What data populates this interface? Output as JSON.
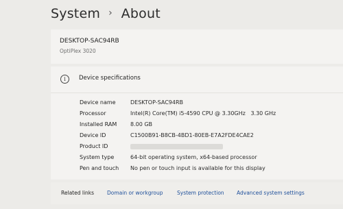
{
  "breadcrumb": {
    "parent": "System",
    "separator": "›",
    "current": "About"
  },
  "device": {
    "name": "DESKTOP-SAC94RB",
    "model": "OptiPlex 3020"
  },
  "specs": {
    "icon": "info-icon",
    "title": "Device specifications",
    "rows": [
      {
        "label": "Device name",
        "value": "DESKTOP-SAC94RB"
      },
      {
        "label": "Processor",
        "value": "Intel(R) Core(TM) i5-4590 CPU @ 3.30GHz   3.30 GHz"
      },
      {
        "label": "Installed RAM",
        "value": "8.00 GB"
      },
      {
        "label": "Device ID",
        "value": "C1500B91-B8CB-4BD1-80EB-E7A2FDE4CAE2"
      },
      {
        "label": "Product ID",
        "value": ""
      },
      {
        "label": "System type",
        "value": "64-bit operating system, x64-based processor"
      },
      {
        "label": "Pen and touch",
        "value": "No pen or touch input is available for this display"
      }
    ]
  },
  "related": {
    "label": "Related links",
    "links": [
      "Domain or workgroup",
      "System protection",
      "Advanced system settings"
    ]
  }
}
